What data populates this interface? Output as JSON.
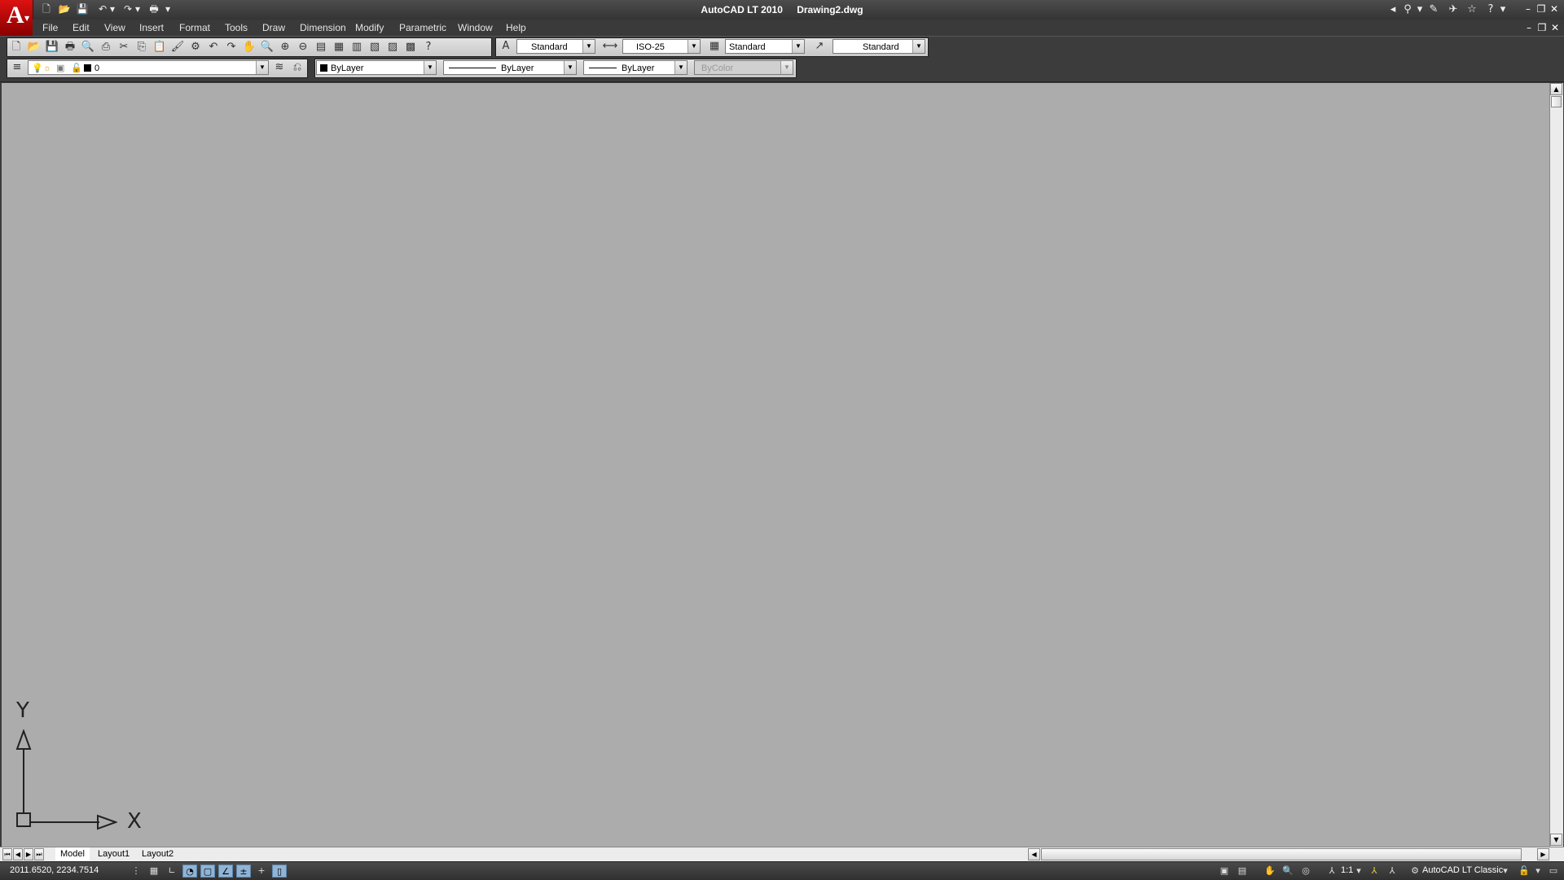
{
  "title": {
    "app": "AutoCAD LT 2010",
    "document": "Drawing2.dwg"
  },
  "menu": [
    "File",
    "Edit",
    "View",
    "Insert",
    "Format",
    "Tools",
    "Draw",
    "Dimension",
    "Modify",
    "Parametric",
    "Window",
    "Help"
  ],
  "styles": {
    "text_style": "Standard",
    "dim_style": "ISO-25",
    "table_style": "Standard",
    "multileader_style": "Standard"
  },
  "layers": {
    "current_layer": "0",
    "color": "ByLayer",
    "linetype": "ByLayer",
    "lineweight": "ByLayer",
    "plot_style": "ByColor"
  },
  "ucs": {
    "x_label": "X",
    "y_label": "Y"
  },
  "tabs": [
    "Model",
    "Layout1",
    "Layout2"
  ],
  "status": {
    "coords": "2011.6520, 2234.7514",
    "annotation_scale": "1:1",
    "workspace": "AutoCAD LT Classic"
  },
  "colors": {
    "canvas": "#acacac",
    "logo": "#cc1111",
    "toggle_on": "#8fb4d6"
  }
}
